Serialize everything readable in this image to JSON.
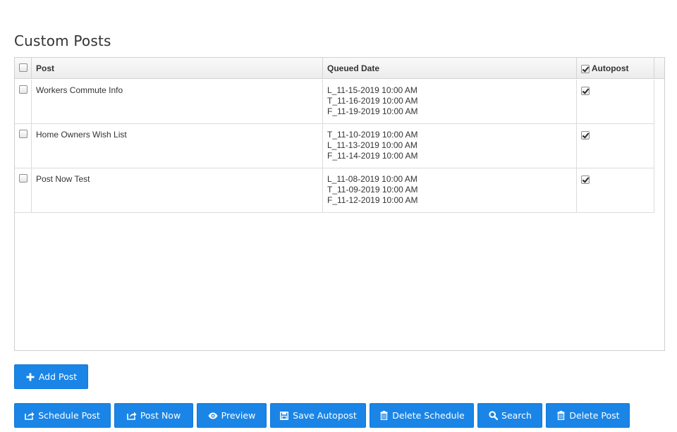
{
  "page": {
    "title": "Custom Posts"
  },
  "table": {
    "columns": {
      "post": "Post",
      "queued_date": "Queued Date",
      "autopost": "Autopost"
    },
    "header_autopost_checked": true,
    "rows": [
      {
        "post": "Workers Commute Info",
        "dates": [
          "L_11-15-2019 10:00 AM",
          "T_11-16-2019 10:00 AM",
          "F_11-19-2019 10:00 AM"
        ],
        "autopost": true
      },
      {
        "post": "Home Owners Wish List",
        "dates": [
          "T_11-10-2019 10:00 AM",
          "L_11-13-2019 10:00 AM",
          "F_11-14-2019 10:00 AM"
        ],
        "autopost": true
      },
      {
        "post": "Post Now Test",
        "dates": [
          "L_11-08-2019 10:00 AM",
          "T_11-09-2019 10:00 AM",
          "F_11-12-2019 10:00 AM"
        ],
        "autopost": true
      }
    ]
  },
  "buttons": {
    "add_post": "Add Post",
    "schedule_post": "Schedule Post",
    "post_now": "Post Now",
    "preview": "Preview",
    "save_autopost": "Save Autopost",
    "delete_schedule": "Delete Schedule",
    "search": "Search",
    "delete_post": "Delete Post"
  },
  "icons": {
    "add_post": "plus-icon",
    "schedule_post": "share-icon",
    "post_now": "share-icon",
    "preview": "eye-icon",
    "save_autopost": "save-icon",
    "delete_schedule": "trash-icon",
    "search": "search-icon",
    "delete_post": "trash-icon"
  },
  "colors": {
    "button": "#1a85e6",
    "text": "#333333"
  }
}
